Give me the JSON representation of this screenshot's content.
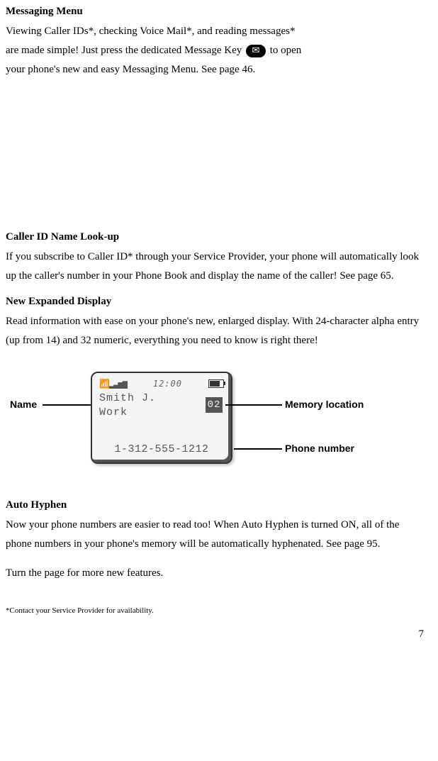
{
  "sections": {
    "messaging": {
      "heading": "Messaging Menu",
      "line1": "Viewing Caller IDs*, checking Voice Mail*, and reading messages*",
      "line2a": "are made simple! Just press the dedicated Message Key",
      "line2b": " to open",
      "line3": "your phone's new and easy Messaging Menu. See page 46."
    },
    "callerid": {
      "heading": "Caller ID Name Look-up",
      "body": "If you subscribe to Caller ID* through your Service Provider, your phone will automatically look up the caller's number in your Phone Book and display the name of the caller! See page 65."
    },
    "display": {
      "heading": "New Expanded Display",
      "body": "Read information with ease on your phone's new, enlarged display. With 24-character alpha entry (up from 14) and 32 numeric, everything you need to know is right there!"
    },
    "lcd": {
      "clock": "12:00",
      "name_line1": "Smith J.",
      "name_line2": "Work",
      "memory": "02",
      "phone": "1-312-555-1212"
    },
    "callouts": {
      "name": "Name",
      "memory": "Memory location",
      "phone": "Phone number"
    },
    "autohyphen": {
      "heading": "Auto Hyphen",
      "body1a": "Now your phone numbers are easier to read too! When Auto Hyphen is turned ",
      "body1b": "ON",
      "body1c": ", all of the phone numbers in your phone's memory will be automatically hyphenated. See page 95.",
      "body2": "Turn the page for more new features."
    },
    "footnote": "*Contact your Service Provider for availability.",
    "page": "7"
  }
}
